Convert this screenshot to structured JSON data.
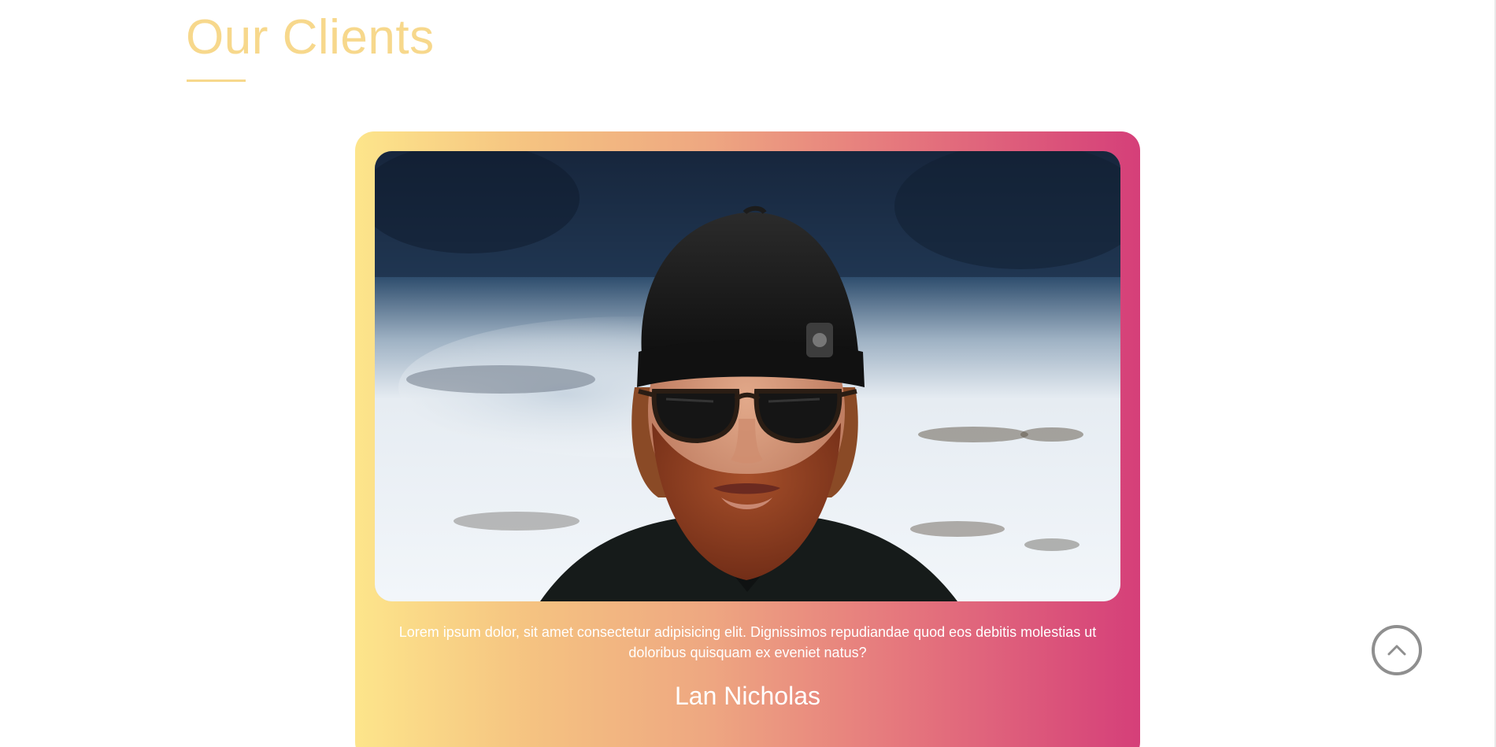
{
  "section": {
    "title": "Our Clients"
  },
  "testimonial": {
    "photo_icon": "client-portrait-image",
    "quote": "Lorem ipsum dolor, sit amet consectetur adipisicing elit. Dignissimos repudiandae quod eos debitis molestias ut doloribus quisquam ex eveniet natus?",
    "name": "Lan Nicholas"
  },
  "scroll_top": {
    "icon": "chevron-up-icon"
  },
  "colors": {
    "title": "#f7d88c",
    "gradient_start": "#fde58b",
    "gradient_end": "#d53f79",
    "text_on_card": "#ffffff",
    "scroll_button_border": "#8f8f8f"
  }
}
